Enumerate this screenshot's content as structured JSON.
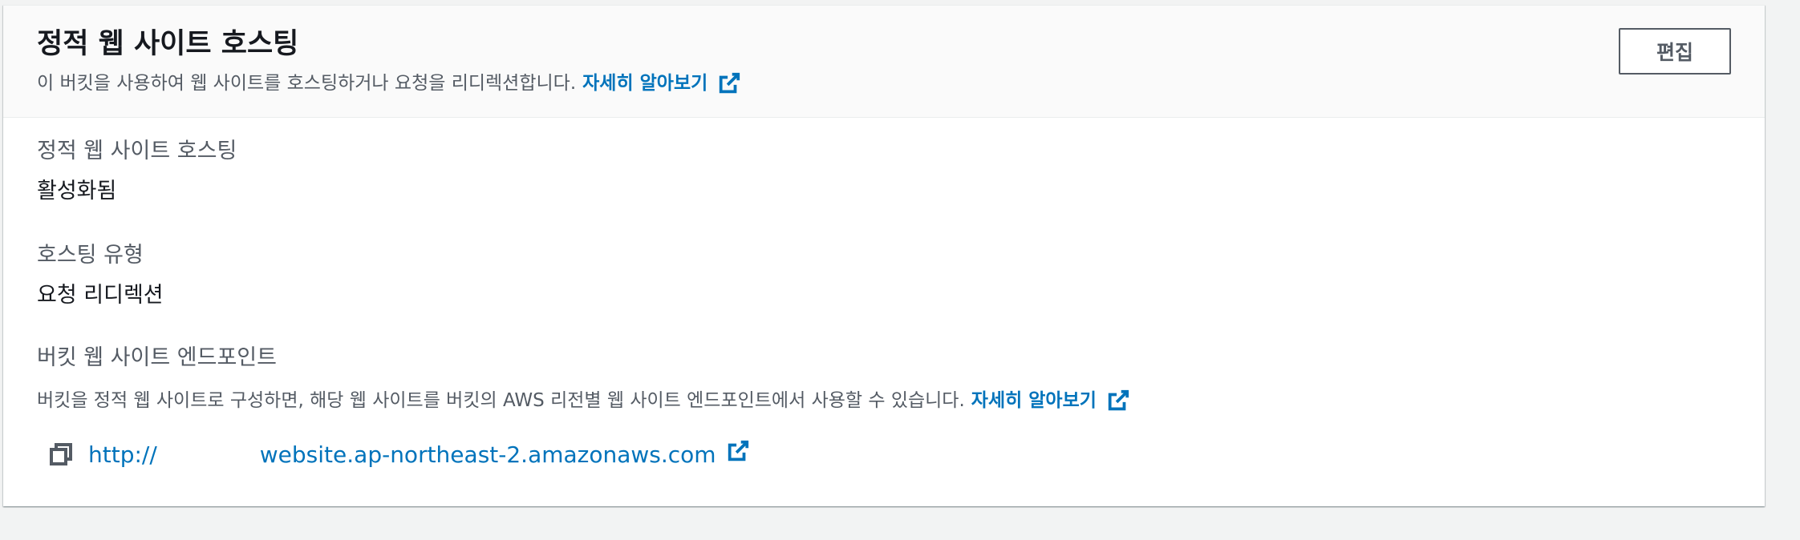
{
  "header": {
    "title": "정적 웹 사이트 호스팅",
    "description": "이 버킷을 사용하여 웹 사이트를 호스팅하거나 요청을 리디렉션합니다.",
    "learn_more": "자세히 알아보기",
    "edit_label": "편집"
  },
  "fields": {
    "hosting": {
      "label": "정적 웹 사이트 호스팅",
      "value": "활성화됨"
    },
    "hosting_type": {
      "label": "호스팅 유형",
      "value": "요청 리디렉션"
    },
    "endpoint": {
      "label": "버킷 웹 사이트 엔드포인트",
      "description": "버킷을 정적 웹 사이트로 구성하면, 해당 웹 사이트를 버킷의 AWS 리전별 웹 사이트 엔드포인트에서 사용할 수 있습니다.",
      "learn_more": "자세히 알아보기",
      "url_prefix": "http://",
      "url_suffix": "website.ap-northeast-2.amazonaws.com"
    }
  },
  "icons": {
    "external": "external-link-icon",
    "copy": "copy-icon"
  },
  "colors": {
    "link": "#0073bb",
    "text": "#16191f",
    "secondary_text": "#545b64",
    "header_bg": "#fafafa",
    "page_bg": "#f2f3f3"
  }
}
